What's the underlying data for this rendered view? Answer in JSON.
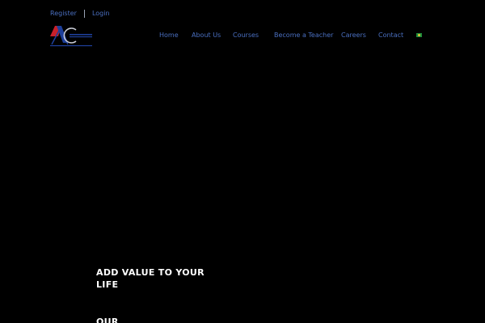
{
  "top_links": {
    "register": "Register",
    "login": "Login"
  },
  "nav": {
    "items": [
      {
        "label": "Home"
      },
      {
        "label": "About Us"
      },
      {
        "label": "Courses"
      },
      {
        "label": "Become a Teacher"
      },
      {
        "label": "Careers"
      },
      {
        "label": "Contact"
      }
    ],
    "language_flag": "brazil-flag-icon"
  },
  "hero": {
    "title": "ADD VALUE TO YOUR LIFE",
    "subtitle": "OUR"
  },
  "colors": {
    "background": "#000000",
    "link": "#4a6fc0",
    "hero_text": "#ffffff",
    "logo_red": "#c8202a",
    "logo_blue": "#1e3f9a"
  }
}
